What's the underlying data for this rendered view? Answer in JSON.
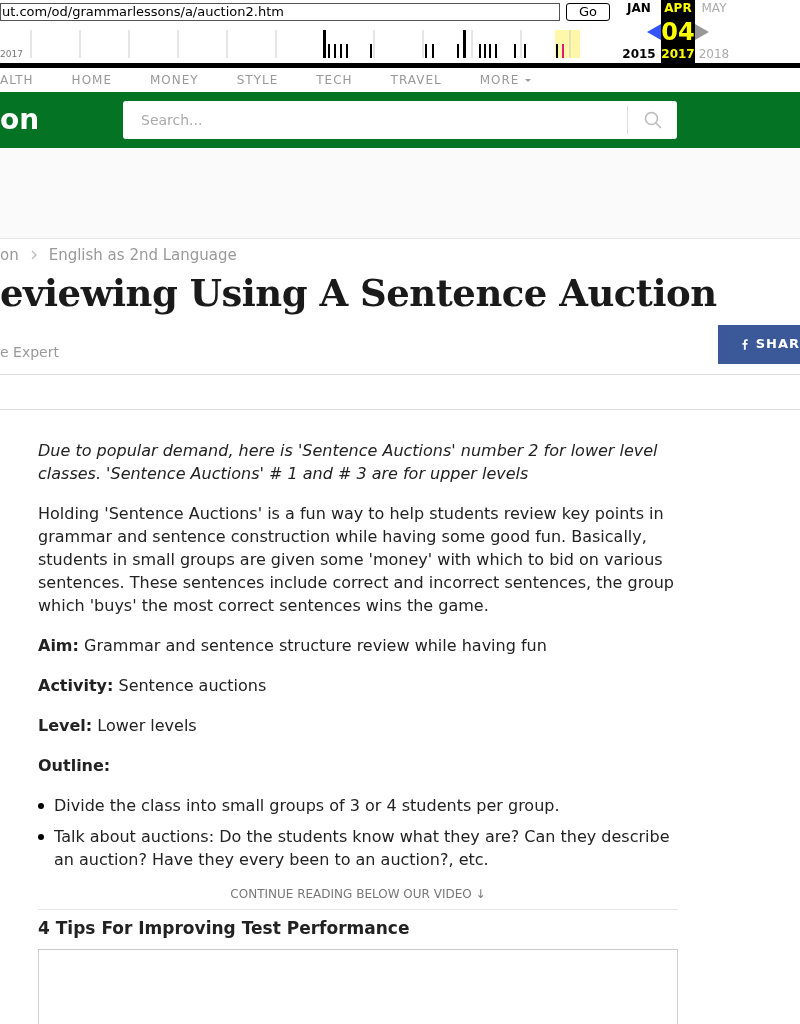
{
  "wayback": {
    "url": "ut.com/od/grammarlessons/a/auction2.htm",
    "go": "Go",
    "timeline_year": "2017",
    "months": [
      {
        "label": "JAN",
        "year": "2015",
        "selected": false,
        "kind": "prev"
      },
      {
        "label": "APR",
        "day": "04",
        "year": "2017",
        "selected": true
      },
      {
        "label": "MAY",
        "year": "2018",
        "selected": false,
        "kind": "next"
      }
    ]
  },
  "nav": [
    {
      "label": "ALTH"
    },
    {
      "label": "HOME"
    },
    {
      "label": "MONEY"
    },
    {
      "label": "STYLE"
    },
    {
      "label": "TECH"
    },
    {
      "label": "TRAVEL"
    },
    {
      "label": "MORE",
      "dropdown": true
    }
  ],
  "header": {
    "logo": "on",
    "search_placeholder": "Search..."
  },
  "breadcrumb": [
    "on",
    "English as 2nd Language"
  ],
  "title": "eviewing Using A Sentence Auction",
  "byline": "e Expert",
  "share": "SHAR",
  "intro": "Due to popular demand, here is 'Sentence Auctions' number 2 for lower level classes. 'Sentence Auctions' # 1 and # 3 are for upper levels",
  "paragraph": "Holding 'Sentence Auctions' is a fun way to help students review key points in grammar and sentence construction while having some good fun. Basically, students in small groups are given some 'money' with which to bid on various sentences. These sentences include correct and incorrect sentences, the group which 'buys' the most correct sentences wins the game.",
  "fields": [
    "**Aim:** Grammar and sentence structure review while having fun",
    "**Activity:** Sentence auctions",
    "**Level:** Lower levels"
  ],
  "outline_heading": "Outline:",
  "outline": [
    "Divide the class into small groups of 3 or 4 students per group.",
    "Talk about auctions: Do the students know what they are? Can they describe an auction? Have they every been to an auction?, etc."
  ],
  "continue": "CONTINUE READING BELOW OUR VIDEO ↓",
  "video_title": "4 Tips For Improving Test Performance"
}
